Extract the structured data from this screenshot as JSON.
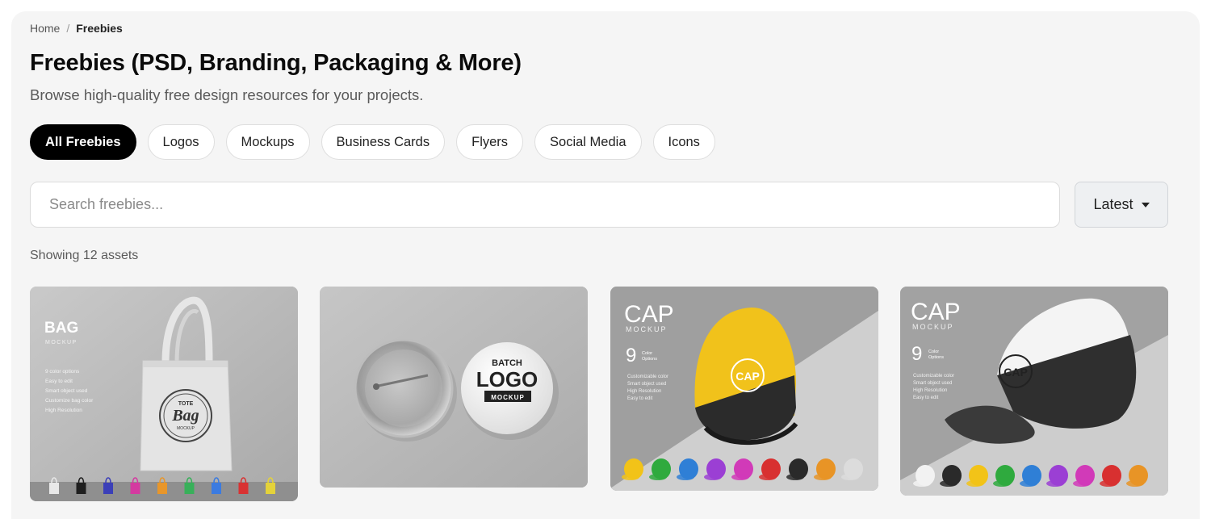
{
  "breadcrumb": {
    "home": "Home",
    "separator": "/",
    "current": "Freebies"
  },
  "page": {
    "title": "Freebies (PSD, Branding, Packaging & More)",
    "subtitle": "Browse high-quality free design resources for your projects."
  },
  "filters": [
    {
      "label": "All Freebies",
      "active": true
    },
    {
      "label": "Logos",
      "active": false
    },
    {
      "label": "Mockups",
      "active": false
    },
    {
      "label": "Business Cards",
      "active": false
    },
    {
      "label": "Flyers",
      "active": false
    },
    {
      "label": "Social Media",
      "active": false
    },
    {
      "label": "Icons",
      "active": false
    }
  ],
  "search": {
    "placeholder": "Search freebies...",
    "value": ""
  },
  "sort": {
    "selected": "Latest",
    "icon": "caret-down-icon"
  },
  "results": {
    "count_text": "Showing 12 assets"
  },
  "cards": [
    {
      "heading": "BAG",
      "subheading": "MOCKUP",
      "features": [
        "9 color options",
        "Easy to edit",
        "Smart object used",
        "Customize bag color",
        "High Resolution"
      ],
      "product_text_top": "TOTE",
      "product_text_main": "Bag",
      "product_text_bottom": "MOCKUP",
      "swatches": [
        "#e8e8e8",
        "#1f1f1f",
        "#3b3fb8",
        "#d43aa0",
        "#e8962a",
        "#38b05a",
        "#3b7be0",
        "#d93232",
        "#e4d23a"
      ]
    },
    {
      "badge_top": "BATCH",
      "badge_main": "LOGO",
      "badge_bottom": "MOCKUP"
    },
    {
      "heading": "CAP",
      "subheading": "MOCKUP",
      "count": "9",
      "count_label_1": "Color",
      "count_label_2": "Options",
      "features": [
        "Customizable color",
        "Smart object used",
        "High Resolution",
        "Easy to edit"
      ],
      "product_text": "CAP",
      "swatches": [
        "#f2c318",
        "#2faa3e",
        "#2f7fd6",
        "#9b3fd4",
        "#d13ab8",
        "#d83030",
        "#2a2a2a",
        "#e89426",
        "#dcdcdc"
      ]
    },
    {
      "heading": "CAP",
      "subheading": "MOCKUP",
      "count": "9",
      "count_label_1": "Color",
      "count_label_2": "Options",
      "features": [
        "Customizable color",
        "Smart object used",
        "High Resolution",
        "Easy to edit"
      ],
      "product_text": "CAP",
      "swatches": [
        "#f2f2f2",
        "#2a2a2a",
        "#f2c318",
        "#2faa3e",
        "#2f7fd6",
        "#9b3fd4",
        "#d13ab8",
        "#d83030",
        "#e89426"
      ]
    }
  ]
}
